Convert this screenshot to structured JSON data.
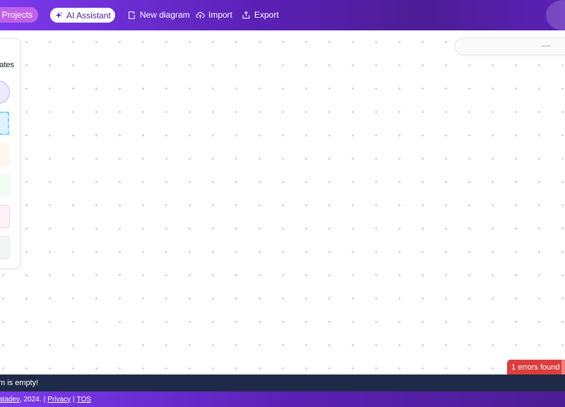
{
  "header": {
    "projects_label": "Projects",
    "ai_assistant_label": "AI Assistant",
    "new_diagram_label": "New diagram",
    "import_label": "Import",
    "export_label": "Export"
  },
  "templates": {
    "title": "ates"
  },
  "errors": {
    "badge_label": "1 errors found"
  },
  "status": {
    "message": "m is empty!"
  },
  "footer": {
    "brand_link": "atadev",
    "year_text": ", 2024.",
    "separator": "|",
    "privacy_link": "Privacy",
    "tos_link": "TOS"
  },
  "icons": {
    "ai": "sparkle-icon",
    "new_diagram": "new-file-icon",
    "import": "cloud-upload-icon",
    "export": "share-upload-icon"
  },
  "colors": {
    "accent": "#6d28d9",
    "error": "#dc3d3d",
    "status_bar": "#1e2a47"
  }
}
